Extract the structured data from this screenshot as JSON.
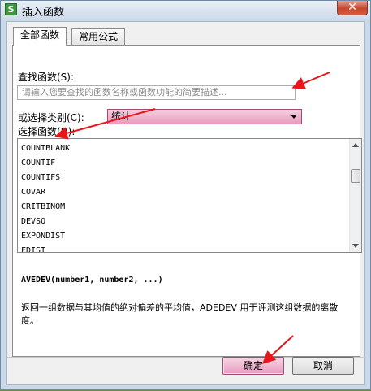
{
  "window": {
    "title": "插入函数",
    "app_icon_letter": "S",
    "close_glyph": "✕"
  },
  "tabs": [
    {
      "label": "全部函数",
      "active": true
    },
    {
      "label": "常用公式",
      "active": false
    }
  ],
  "search": {
    "label": "查找函数(S):",
    "placeholder": "请输入您要查找的函数名称或函数功能的简要描述..."
  },
  "category": {
    "label": "或选择类别(C):",
    "selected": "统计"
  },
  "function_list": {
    "label": "选择函数(N):",
    "items": [
      "COUNTBLANK",
      "COUNTIF",
      "COUNTIFS",
      "COVAR",
      "CRITBINOM",
      "DEVSQ",
      "EXPONDIST",
      "FDIST"
    ]
  },
  "detail": {
    "signature": "AVEDEV(number1, number2, ...)",
    "description": "返回一组数据与其均值的绝对偏差的平均值，ADEDEV 用于评测这组数据的离散度。"
  },
  "buttons": {
    "ok": "确定",
    "cancel": "取消"
  },
  "annotations": {
    "arrow_color": "#e8161b"
  }
}
